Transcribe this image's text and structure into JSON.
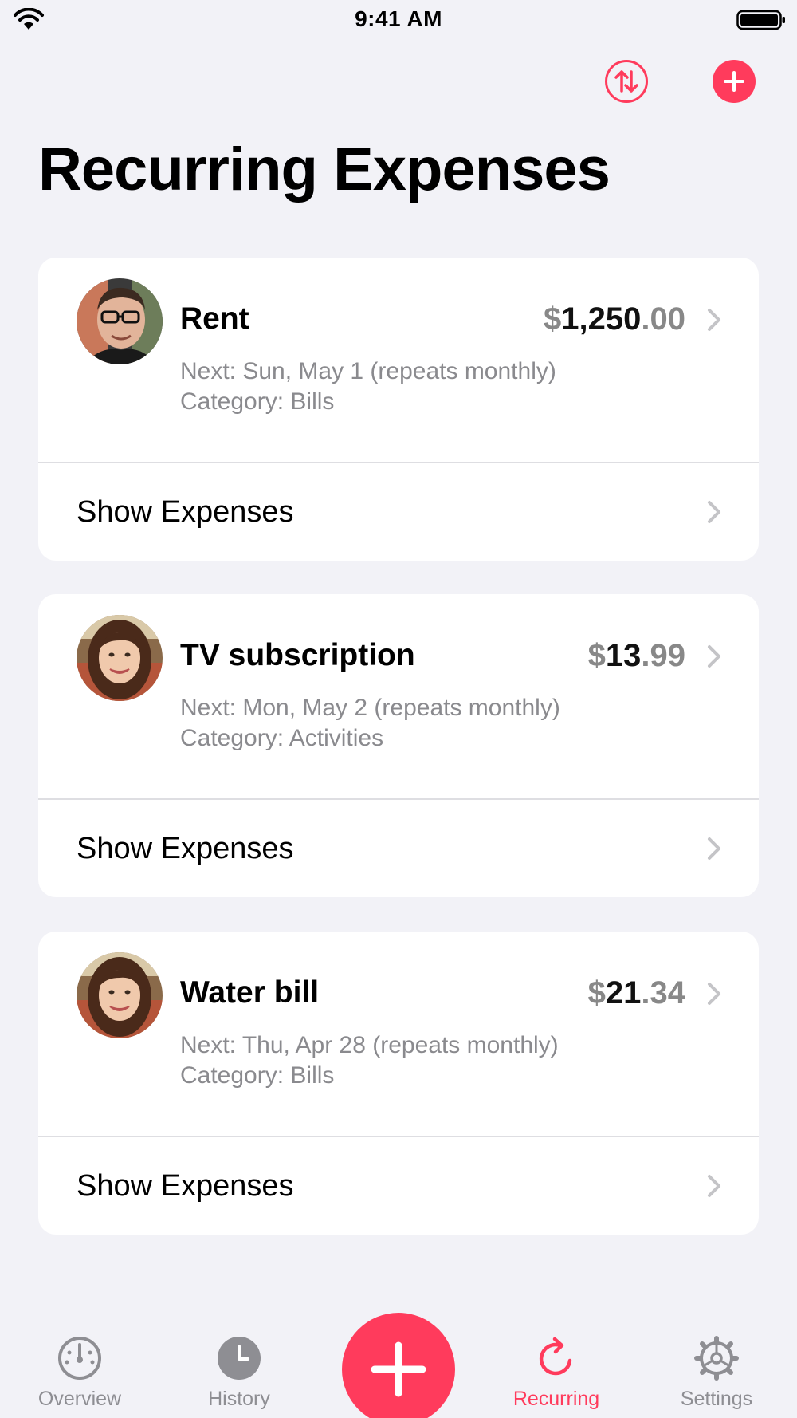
{
  "status_bar": {
    "time": "9:41 AM"
  },
  "header": {
    "title": "Recurring Expenses",
    "sort_icon": "sort-arrows-icon",
    "add_icon": "plus-circle-icon"
  },
  "expenses": [
    {
      "name": "Rent",
      "currency": "$",
      "amount_whole": "1,250",
      "amount_cents": ".00",
      "next": "Next: Sun, May 1 (repeats monthly)",
      "category": "Category: Bills",
      "show_label": "Show Expenses"
    },
    {
      "name": "TV subscription",
      "currency": "$",
      "amount_whole": "13",
      "amount_cents": ".99",
      "next": "Next: Mon, May 2 (repeats monthly)",
      "category": "Category: Activities",
      "show_label": "Show Expenses"
    },
    {
      "name": "Water bill",
      "currency": "$",
      "amount_whole": "21",
      "amount_cents": ".34",
      "next": "Next: Thu, Apr 28 (repeats monthly)",
      "category": "Category: Bills",
      "show_label": "Show Expenses"
    }
  ],
  "tab_bar": {
    "items": [
      {
        "label": "Overview",
        "icon": "gauge-icon"
      },
      {
        "label": "History",
        "icon": "clock-icon"
      },
      {
        "label": "Recurring",
        "icon": "repeat-icon",
        "active": true
      },
      {
        "label": "Settings",
        "icon": "gear-icon"
      }
    ],
    "fab_icon": "plus-icon"
  },
  "colors": {
    "accent": "#ff3b5c",
    "background": "#f2f2f7",
    "card": "#ffffff",
    "secondary_text": "#8a8a8e"
  }
}
